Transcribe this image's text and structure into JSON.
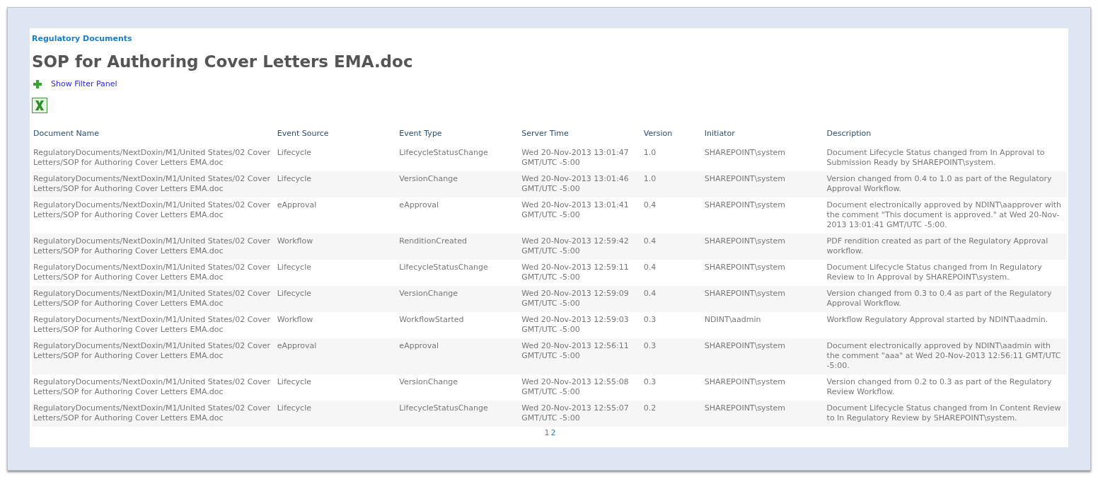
{
  "breadcrumb": "Regulatory Documents",
  "title": "SOP for Authoring Cover Letters EMA.doc",
  "filter_toggle": {
    "label": "Show Filter Panel"
  },
  "table": {
    "columns": [
      "Document Name",
      "Event Source",
      "Event Type",
      "Server Time",
      "Version",
      "Initiator",
      "Description"
    ],
    "rows": [
      [
        "RegulatoryDocuments/NextDoxin/M1/United States/02 Cover Letters/SOP for Authoring Cover Letters EMA.doc",
        "Lifecycle",
        "LifecycleStatusChange",
        "Wed 20-Nov-2013 13:01:47 GMT/UTC -5:00",
        "1.0",
        "SHAREPOINT\\system",
        "Document Lifecycle Status changed from In Approval to Submission Ready by SHAREPOINT\\system."
      ],
      [
        "RegulatoryDocuments/NextDoxin/M1/United States/02 Cover Letters/SOP for Authoring Cover Letters EMA.doc",
        "Lifecycle",
        "VersionChange",
        "Wed 20-Nov-2013 13:01:46 GMT/UTC -5:00",
        "1.0",
        "SHAREPOINT\\system",
        "Version changed from 0.4 to 1.0 as part of the Regulatory Approval Workflow."
      ],
      [
        "RegulatoryDocuments/NextDoxin/M1/United States/02 Cover Letters/SOP for Authoring Cover Letters EMA.doc",
        "eApproval",
        "eApproval",
        "Wed 20-Nov-2013 13:01:41 GMT/UTC -5:00",
        "0.4",
        "SHAREPOINT\\system",
        "Document electronically approved by NDINT\\aapprover with the comment \"This document is approved.\" at Wed 20-Nov-2013 13:01:41 GMT/UTC -5:00."
      ],
      [
        "RegulatoryDocuments/NextDoxin/M1/United States/02 Cover Letters/SOP for Authoring Cover Letters EMA.doc",
        "Workflow",
        "RenditionCreated",
        "Wed 20-Nov-2013 12:59:42 GMT/UTC -5:00",
        "0.4",
        "SHAREPOINT\\system",
        "PDF rendition created as part of the Regulatory Approval workflow."
      ],
      [
        "RegulatoryDocuments/NextDoxin/M1/United States/02 Cover Letters/SOP for Authoring Cover Letters EMA.doc",
        "Lifecycle",
        "LifecycleStatusChange",
        "Wed 20-Nov-2013 12:59:11 GMT/UTC -5:00",
        "0.4",
        "SHAREPOINT\\system",
        "Document Lifecycle Status changed from In Regulatory Review to In Approval by SHAREPOINT\\system."
      ],
      [
        "RegulatoryDocuments/NextDoxin/M1/United States/02 Cover Letters/SOP for Authoring Cover Letters EMA.doc",
        "Lifecycle",
        "VersionChange",
        "Wed 20-Nov-2013 12:59:09 GMT/UTC -5:00",
        "0.4",
        "SHAREPOINT\\system",
        "Version changed from 0.3 to 0.4 as part of the Regulatory Approval Workflow."
      ],
      [
        "RegulatoryDocuments/NextDoxin/M1/United States/02 Cover Letters/SOP for Authoring Cover Letters EMA.doc",
        "Workflow",
        "WorkflowStarted",
        "Wed 20-Nov-2013 12:59:03 GMT/UTC -5:00",
        "0.3",
        "NDINT\\aadmin",
        "Workflow Regulatory Approval started by NDINT\\aadmin."
      ],
      [
        "RegulatoryDocuments/NextDoxin/M1/United States/02 Cover Letters/SOP for Authoring Cover Letters EMA.doc",
        "eApproval",
        "eApproval",
        "Wed 20-Nov-2013 12:56:11 GMT/UTC -5:00",
        "0.3",
        "SHAREPOINT\\system",
        "Document electronically approved by NDINT\\aadmin with the comment \"aaa\" at Wed 20-Nov-2013 12:56:11 GMT/UTC -5:00."
      ],
      [
        "RegulatoryDocuments/NextDoxin/M1/United States/02 Cover Letters/SOP for Authoring Cover Letters EMA.doc",
        "Lifecycle",
        "VersionChange",
        "Wed 20-Nov-2013 12:55:08 GMT/UTC -5:00",
        "0.3",
        "SHAREPOINT\\system",
        "Version changed from 0.2 to 0.3 as part of the Regulatory Review Workflow."
      ],
      [
        "RegulatoryDocuments/NextDoxin/M1/United States/02 Cover Letters/SOP for Authoring Cover Letters EMA.doc",
        "Lifecycle",
        "LifecycleStatusChange",
        "Wed 20-Nov-2013 12:55:07 GMT/UTC -5:00",
        "0.2",
        "SHAREPOINT\\system",
        "Document Lifecycle Status changed from In Content Review to In Regulatory Review by SHAREPOINT\\system."
      ]
    ]
  },
  "pagination": [
    {
      "label": "1",
      "selected": true
    },
    {
      "label": "2",
      "selected": false
    }
  ]
}
